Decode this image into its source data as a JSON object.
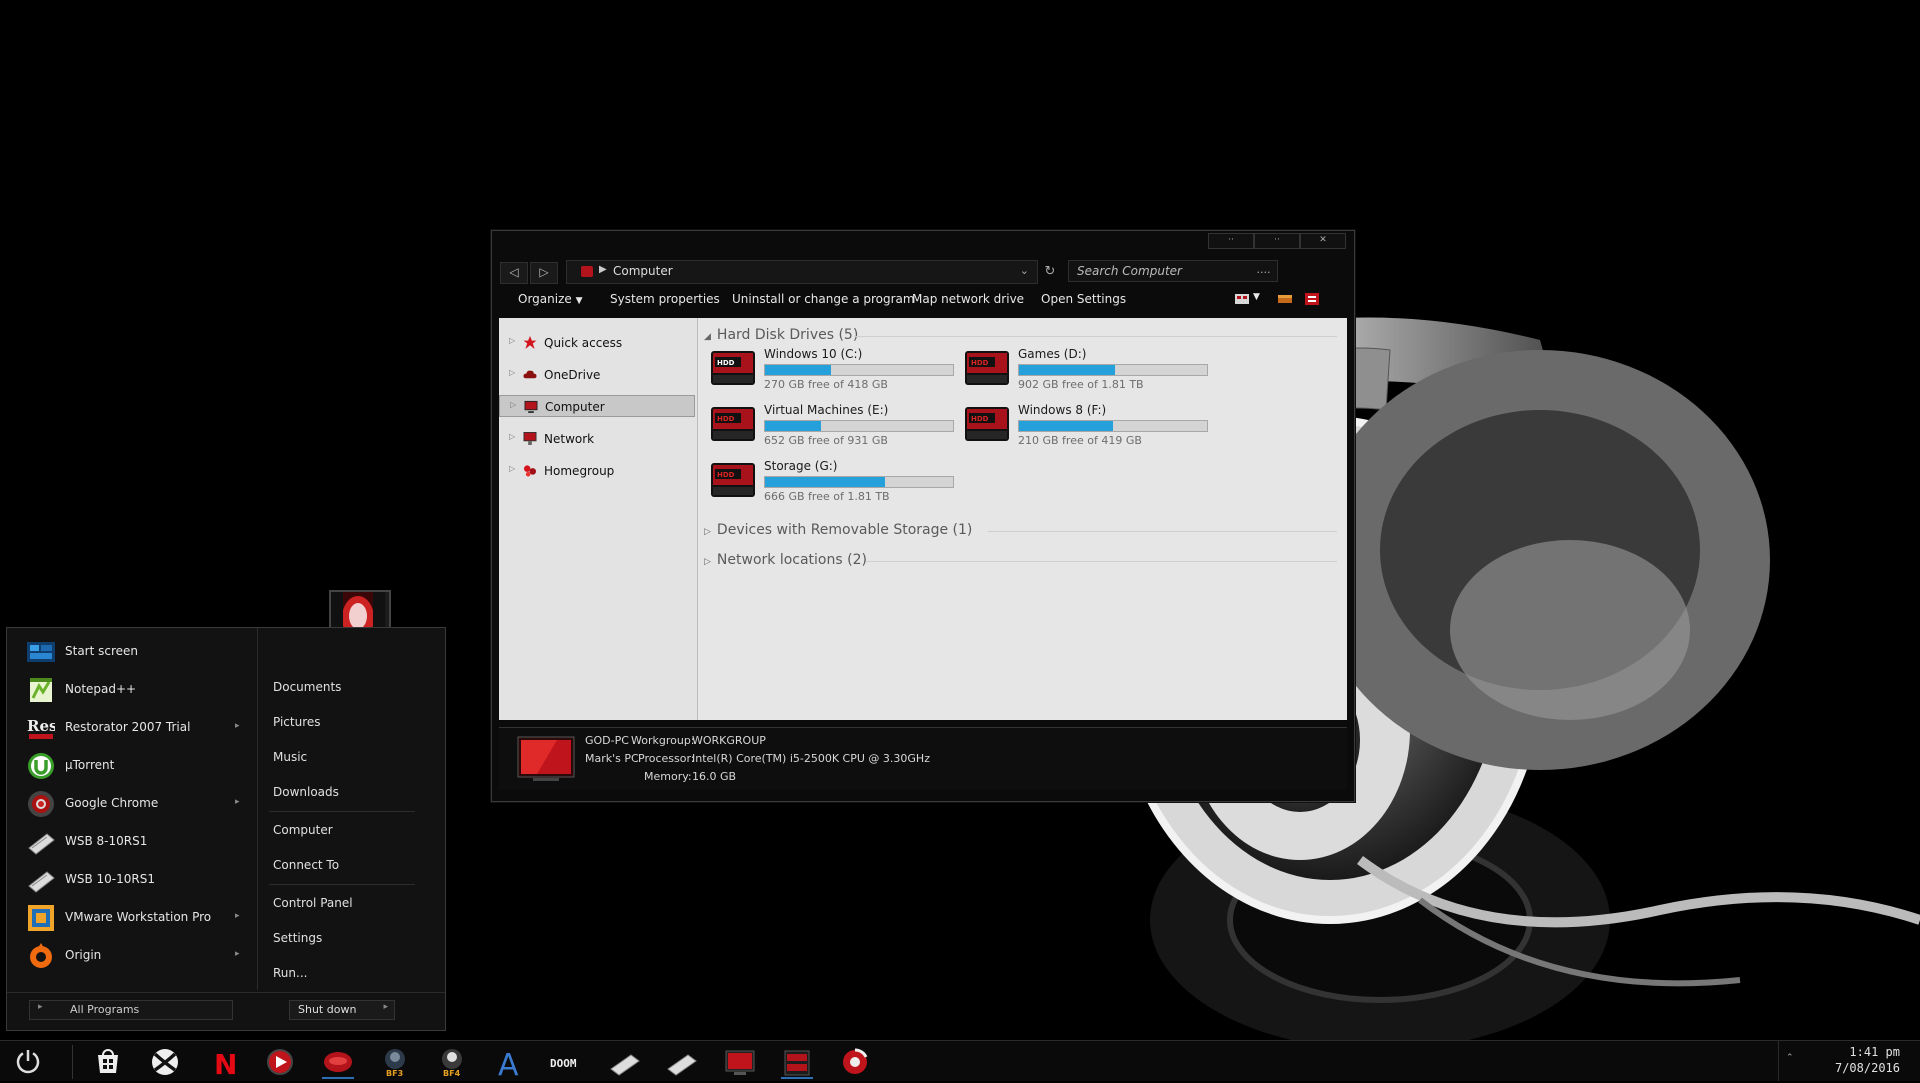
{
  "explorer": {
    "address": "Computer",
    "search_placeholder": "Search Computer",
    "search_more": "....",
    "commands": [
      "Organize",
      "System properties",
      "Uninstall or change a program",
      "Map network drive",
      "Open Settings"
    ],
    "nav": [
      "Quick access",
      "OneDrive",
      "Computer",
      "Network",
      "Homegroup"
    ],
    "groups": {
      "hdd": "Hard Disk Drives (5)",
      "removable": "Devices with Removable Storage (1)",
      "network": "Network locations (2)"
    },
    "drives": [
      {
        "name": "Windows 10 (C:)",
        "free": "270 GB free of 418 GB",
        "used_fraction": 0.35
      },
      {
        "name": "Games (D:)",
        "free": "902 GB free of 1.81 TB",
        "used_fraction": 0.51
      },
      {
        "name": "Virtual Machines (E:)",
        "free": "652 GB free of 931 GB",
        "used_fraction": 0.3
      },
      {
        "name": "Windows 8 (F:)",
        "free": "210 GB free of 419 GB",
        "used_fraction": 0.5
      },
      {
        "name": "Storage (G:)",
        "free": "666 GB free of 1.81 TB",
        "used_fraction": 0.64
      }
    ],
    "details": {
      "pc_name": "GOD-PC",
      "workgroup_label": "Workgroup:",
      "workgroup": "WORKGROUP",
      "pc_desc": "Mark's PC",
      "processor_label": "Processor:",
      "processor": "Intel(R) Core(TM) i5-2500K CPU @ 3.30GHz",
      "memory_label": "Memory:",
      "memory": "16.0 GB"
    }
  },
  "start_menu": {
    "programs": [
      {
        "label": "Start screen",
        "icon": "start-screen-icon",
        "has_sub": false
      },
      {
        "label": "Notepad++",
        "icon": "notepad-icon",
        "has_sub": false
      },
      {
        "label": "Restorator 2007 Trial",
        "icon": "restorator-icon",
        "has_sub": true
      },
      {
        "label": "µTorrent",
        "icon": "utorrent-icon",
        "has_sub": false
      },
      {
        "label": "Google Chrome",
        "icon": "chrome-icon",
        "has_sub": true
      },
      {
        "label": "WSB 8-10RS1",
        "icon": "wsb-icon",
        "has_sub": false
      },
      {
        "label": "WSB 10-10RS1",
        "icon": "wsb-icon",
        "has_sub": false
      },
      {
        "label": "VMware Workstation Pro",
        "icon": "vmware-icon",
        "has_sub": true
      },
      {
        "label": "Origin",
        "icon": "origin-icon",
        "has_sub": true
      }
    ],
    "right_links": [
      "Documents",
      "Pictures",
      "Music",
      "Downloads",
      "Computer",
      "Connect To",
      "Control Panel",
      "Settings",
      "Run..."
    ],
    "all_programs": "All Programs",
    "shutdown": "Shut down",
    "restorator_icon_text": "Res"
  },
  "taskbar": {
    "icons": [
      "power-icon",
      "store-icon",
      "xbox-icon",
      "netflix-icon",
      "media-player-icon",
      "red-app-icon",
      "bf3-icon",
      "bf4-icon",
      "arma-icon",
      "doom-icon",
      "wsb-icon",
      "wsb-icon",
      "computer-icon",
      "explorer-icon",
      "chrome-icon"
    ],
    "netflix_letter": "N",
    "doom_text": "DOOM",
    "bf3": "BF3",
    "bf4": "BF4",
    "arma_letter": "A",
    "time": "1:41 pm",
    "date": "7/08/2016"
  },
  "colors": {
    "accent_red": "#b3141b",
    "progress_blue": "#26a0da"
  }
}
